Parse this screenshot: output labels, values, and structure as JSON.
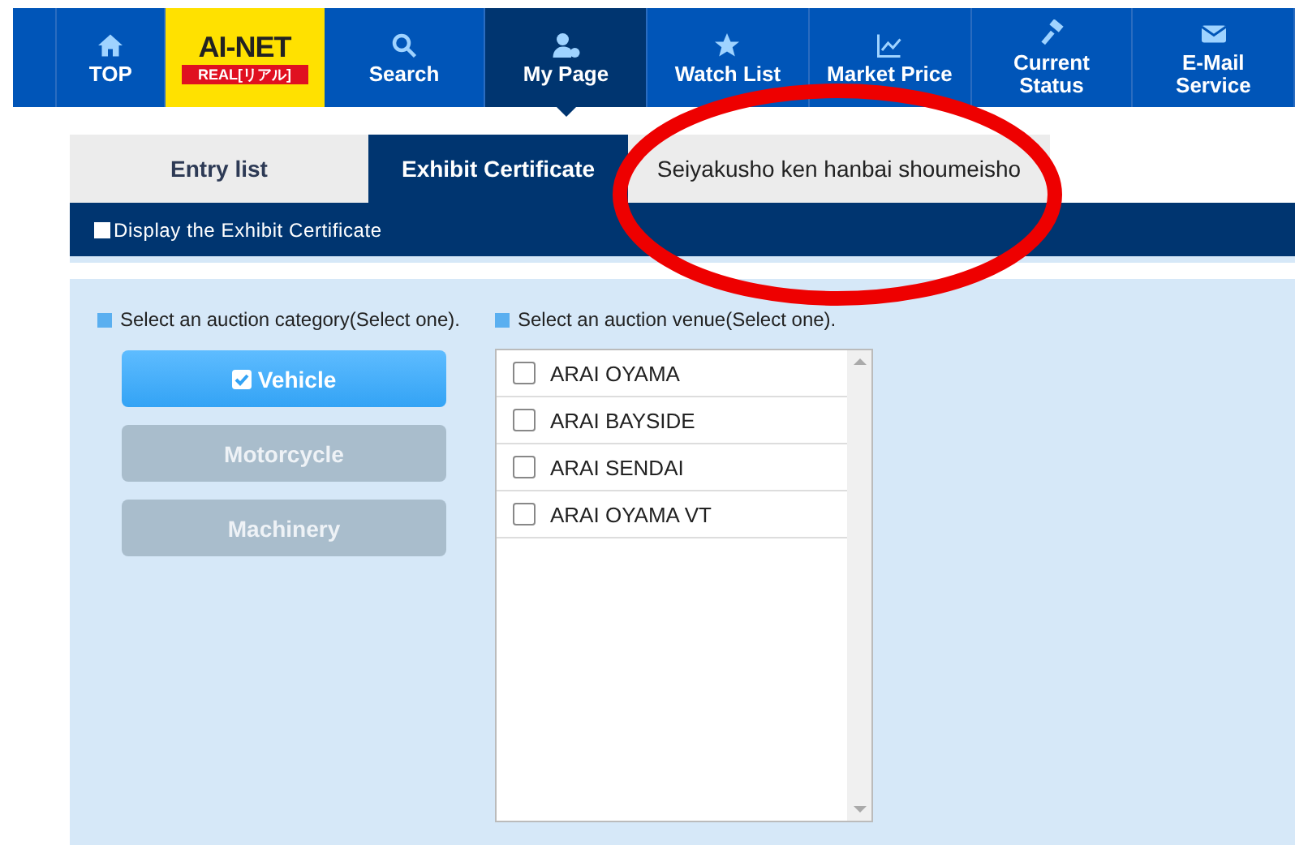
{
  "nav": [
    {
      "kind": "home",
      "label": "TOP",
      "selected": false
    },
    {
      "kind": "logo",
      "label": "AI-NET",
      "sublabel": "REAL[リアル]",
      "selected": false
    },
    {
      "kind": "search",
      "label": "Search",
      "selected": false
    },
    {
      "kind": "user",
      "label": "My Page",
      "selected": true
    },
    {
      "kind": "star",
      "label": "Watch List",
      "selected": false
    },
    {
      "kind": "chart",
      "label": "Market Price",
      "selected": false
    },
    {
      "kind": "gavel",
      "label": "Current Status",
      "selected": false
    },
    {
      "kind": "mail",
      "label": "E-Mail Service",
      "selected": false
    }
  ],
  "tabs": [
    {
      "label": "Entry list",
      "selected": false
    },
    {
      "label": "Exhibit Certificate",
      "selected": true
    },
    {
      "label": "Seiyakusho ken hanbai shoumeisho",
      "selected": false
    }
  ],
  "banner": "Display the Exhibit Certificate",
  "category": {
    "heading": "Select an auction category(Select one).",
    "options": [
      {
        "label": "Vehicle",
        "selected": true
      },
      {
        "label": "Motorcycle",
        "selected": false
      },
      {
        "label": "Machinery",
        "selected": false
      }
    ]
  },
  "venue": {
    "heading": "Select an auction venue(Select one).",
    "options": [
      {
        "label": "ARAI OYAMA",
        "checked": false
      },
      {
        "label": "ARAI BAYSIDE",
        "checked": false
      },
      {
        "label": "ARAI SENDAI",
        "checked": false
      },
      {
        "label": "ARAI OYAMA VT",
        "checked": false
      }
    ]
  }
}
